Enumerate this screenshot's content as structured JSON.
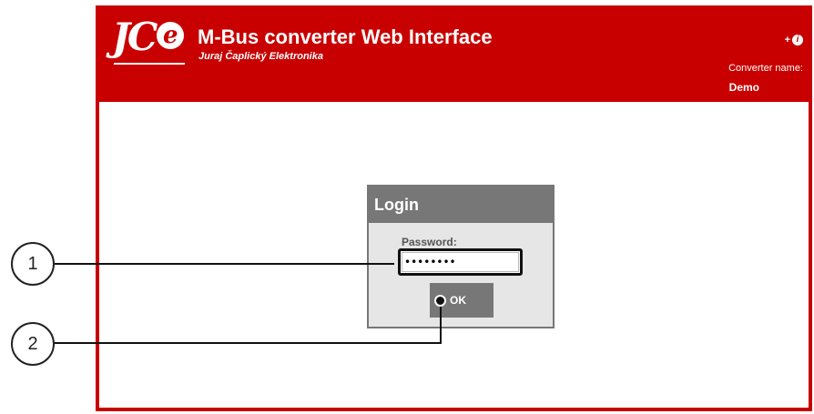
{
  "header": {
    "logo_text": "JC",
    "logo_e": "e",
    "title": "M-Bus converter Web Interface",
    "subtitle": "Juraj Čaplický Elektronika",
    "lang_symbol": "+",
    "info_symbol": "i",
    "converter_label": "Converter name:",
    "converter_name": "Demo"
  },
  "login": {
    "heading": "Login",
    "password_label": "Password:",
    "password_value": "••••••••",
    "ok_label": "OK"
  },
  "callouts": {
    "one": "1",
    "two": "2"
  },
  "colors": {
    "brand_red": "#c80000",
    "panel_gray": "#777777"
  }
}
